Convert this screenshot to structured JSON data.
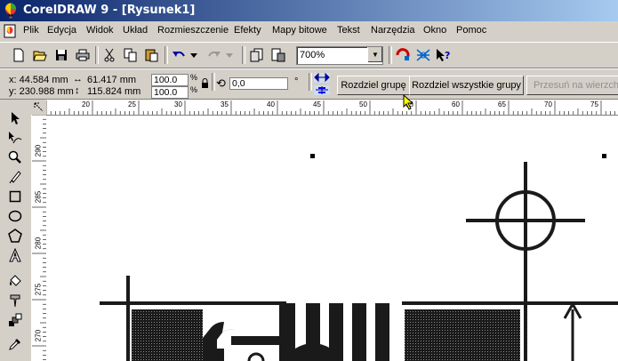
{
  "window": {
    "title": "CorelDRAW 9 - [Rysunek1]"
  },
  "menu": [
    "Plik",
    "Edycja",
    "Widok",
    "Układ",
    "Rozmieszczenie",
    "Efekty",
    "Mapy bitowe",
    "Tekst",
    "Narzędzia",
    "Okno",
    "Pomoc"
  ],
  "toolbar": {
    "zoom": "700%"
  },
  "propbar": {
    "x": "x:  44.584 mm",
    "y": "y:  230.988 mm",
    "width": "61.417 mm",
    "height": "115.824 mm",
    "scale_x": "100.0",
    "scale_y": "100.0",
    "pct1": "%",
    "pct2": "%",
    "rotation": "0,0",
    "degree": "°",
    "ungroup": "Rozdziel grupę",
    "ungroup_all": "Rozdziel wszystkie grupy",
    "to_front": "Przesuń na wierzch"
  },
  "ruler": {
    "h": [
      "20",
      "25",
      "30",
      "35",
      "40",
      "45",
      "50",
      "55",
      "60",
      "65",
      "70",
      "75"
    ],
    "v": [
      "290",
      "285",
      "280",
      "275",
      "270"
    ]
  },
  "colors": {
    "title_start": "#0a246a",
    "title_end": "#a6caf0",
    "chrome": "#d4d0c8"
  }
}
